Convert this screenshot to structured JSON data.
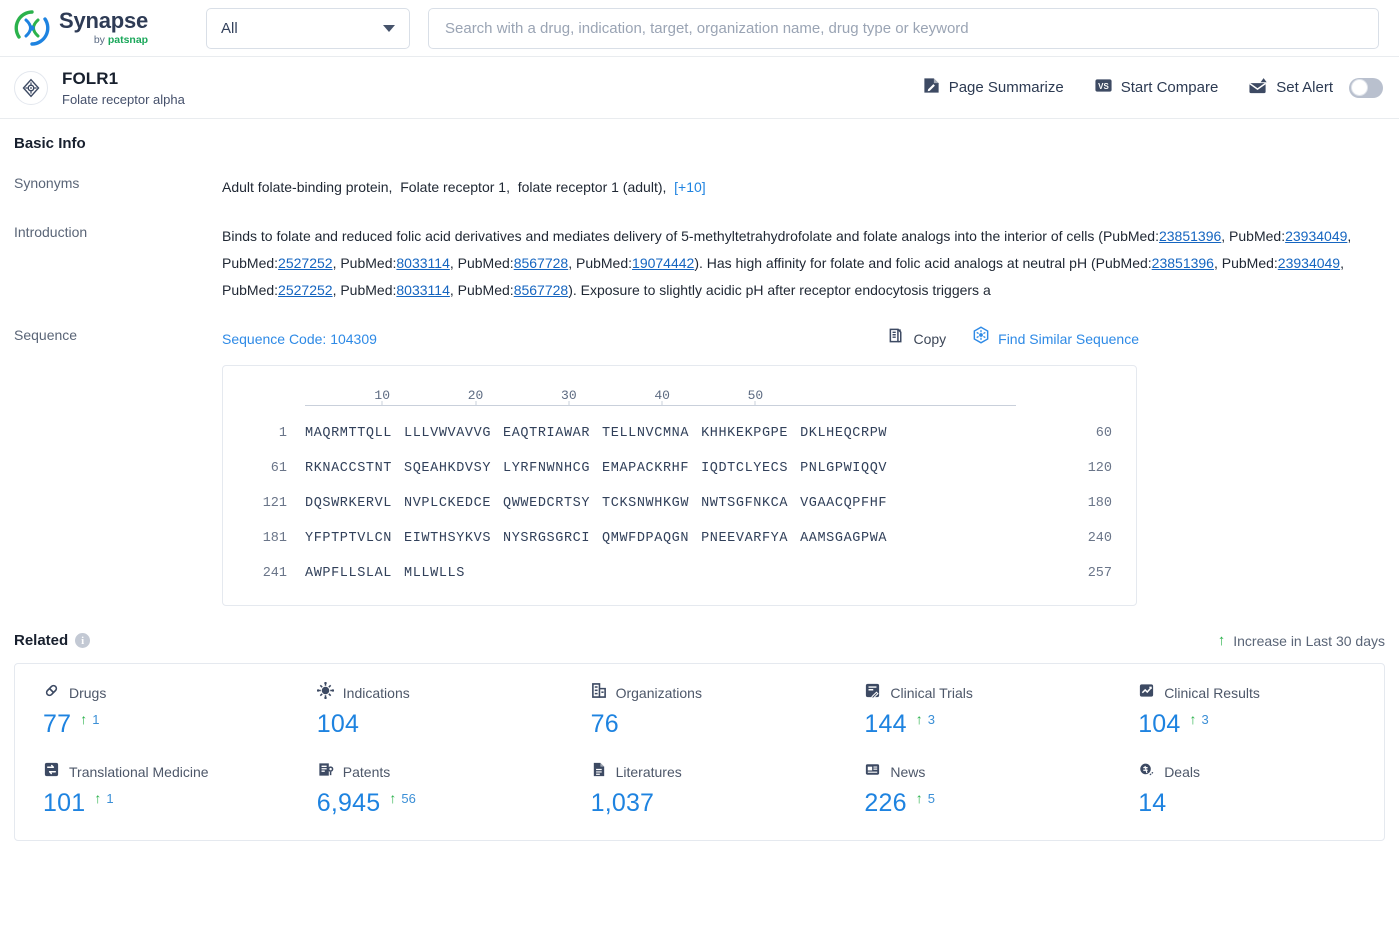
{
  "brand": {
    "name": "Synapse",
    "by": "by",
    "company": "patsnap"
  },
  "search": {
    "scope_value": "All",
    "placeholder": "Search with a drug, indication, target, organization name, drug type or keyword",
    "value": ""
  },
  "entity": {
    "name": "FOLR1",
    "subtitle": "Folate receptor alpha",
    "actions": [
      {
        "label": "Page Summarize",
        "icon": "page-summarize-icon"
      },
      {
        "label": "Start Compare",
        "icon": "versus-icon"
      },
      {
        "label": "Set Alert",
        "icon": "alert-mail-icon"
      }
    ],
    "alert_enabled": false
  },
  "basic_info": {
    "title": "Basic Info",
    "synonyms_label": "Synonyms",
    "synonyms": [
      "Adult folate-binding protein,",
      "Folate receptor 1,",
      "folate receptor 1 (adult),"
    ],
    "synonyms_more": "[+10]",
    "introduction_label": "Introduction",
    "introduction_parts": [
      {
        "t": "Binds to folate and reduced folic acid derivatives and mediates delivery of 5-methyltetrahydrofolate and folate analogs into the interior of cells (PubMed:",
        "k": "text"
      },
      {
        "t": "23851396",
        "k": "link"
      },
      {
        "t": ", PubMed:",
        "k": "text"
      },
      {
        "t": "23934049",
        "k": "link"
      },
      {
        "t": ", PubMed:",
        "k": "text"
      },
      {
        "t": "2527252",
        "k": "link"
      },
      {
        "t": ", PubMed:",
        "k": "text"
      },
      {
        "t": "8033114",
        "k": "link"
      },
      {
        "t": ", PubMed:",
        "k": "text"
      },
      {
        "t": "8567728",
        "k": "link"
      },
      {
        "t": ", PubMed:",
        "k": "text"
      },
      {
        "t": "19074442",
        "k": "link"
      },
      {
        "t": "). Has high affinity for folate and folic acid analogs at neutral pH (PubMed:",
        "k": "text"
      },
      {
        "t": "23851396",
        "k": "link"
      },
      {
        "t": ", PubMed:",
        "k": "text"
      },
      {
        "t": "23934049",
        "k": "link"
      },
      {
        "t": ", PubMed:",
        "k": "text"
      },
      {
        "t": "2527252",
        "k": "link"
      },
      {
        "t": ", PubMed:",
        "k": "text"
      },
      {
        "t": "8033114",
        "k": "link"
      },
      {
        "t": ", PubMed:",
        "k": "text"
      },
      {
        "t": "8567728",
        "k": "link"
      },
      {
        "t": "). Exposure to slightly acidic pH after receptor endocytosis triggers a",
        "k": "text"
      }
    ]
  },
  "sequence": {
    "label": "Sequence",
    "code_label": "Sequence Code: 104309",
    "copy_label": "Copy",
    "find_similar_label": "Find Similar Sequence",
    "ruler_ticks": [
      10,
      20,
      30,
      40,
      50
    ],
    "rows": [
      {
        "start": "1",
        "blocks": [
          "MAQRMTTQLL",
          "LLLVWVAVVG",
          "EAQTRIAWAR",
          "TELLNVCMNA",
          "KHHKEKPGPE",
          "DKLHEQCRPW"
        ],
        "end": "60"
      },
      {
        "start": "61",
        "blocks": [
          "RKNACCSTNT",
          "SQEAHKDVSY",
          "LYRFNWNHCG",
          "EMAPACKRHF",
          "IQDTCLYECS",
          "PNLGPWIQQV"
        ],
        "end": "120"
      },
      {
        "start": "121",
        "blocks": [
          "DQSWRKERVL",
          "NVPLCKEDCE",
          "QWWEDCRTSY",
          "TCKSNWHKGW",
          "NWTSGFNKCA",
          "VGAACQPFHF"
        ],
        "end": "180"
      },
      {
        "start": "181",
        "blocks": [
          "YFPTPTVLCN",
          "EIWTHSYKVS",
          "NYSRGSGRCI",
          "QMWFDPAQGN",
          "PNEEVARFYA",
          "AAMSGAGPWA"
        ],
        "end": "240"
      },
      {
        "start": "241",
        "blocks": [
          "AWPFLLSLAL",
          "MLLWLLS"
        ],
        "end": "257"
      }
    ]
  },
  "related": {
    "title": "Related",
    "info_icon_label": "i",
    "legend": "Increase in Last 30 days",
    "items": [
      {
        "icon": "capsule-icon",
        "label": "Drugs",
        "value": "77",
        "delta": "1"
      },
      {
        "icon": "virus-icon",
        "label": "Indications",
        "value": "104",
        "delta": ""
      },
      {
        "icon": "building-icon",
        "label": "Organizations",
        "value": "76",
        "delta": ""
      },
      {
        "icon": "clinical-trial-icon",
        "label": "Clinical Trials",
        "value": "144",
        "delta": "3"
      },
      {
        "icon": "clinical-result-icon",
        "label": "Clinical Results",
        "value": "104",
        "delta": "3"
      },
      {
        "icon": "translational-icon",
        "label": "Translational Medicine",
        "value": "101",
        "delta": "1"
      },
      {
        "icon": "patent-icon",
        "label": "Patents",
        "value": "6,945",
        "delta": "56"
      },
      {
        "icon": "literature-icon",
        "label": "Literatures",
        "value": "1,037",
        "delta": ""
      },
      {
        "icon": "news-icon",
        "label": "News",
        "value": "226",
        "delta": "5"
      },
      {
        "icon": "deal-icon",
        "label": "Deals",
        "value": "14",
        "delta": ""
      }
    ]
  },
  "colors": {
    "accent_blue": "#1e83e0",
    "link_blue": "#1565c0",
    "increase_green": "#2bb24c",
    "dark_navy": "#2e3b55"
  }
}
